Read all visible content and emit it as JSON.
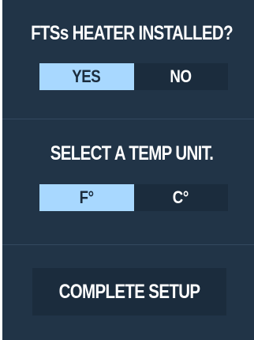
{
  "heater": {
    "title": "FTSs HEATER INSTALLED?",
    "options": [
      "YES",
      "NO"
    ],
    "selected": "YES"
  },
  "temp_unit": {
    "title": "SELECT A TEMP UNIT.",
    "options": [
      "F°",
      "C°"
    ],
    "selected": "F°"
  },
  "complete": {
    "label": "COMPLETE SETUP"
  },
  "colors": {
    "panel_bg": "#213447",
    "control_bg": "#1b2c3d",
    "active_bg": "#a8d8ff",
    "active_text": "#1b2c3d",
    "text": "#ffffff"
  }
}
